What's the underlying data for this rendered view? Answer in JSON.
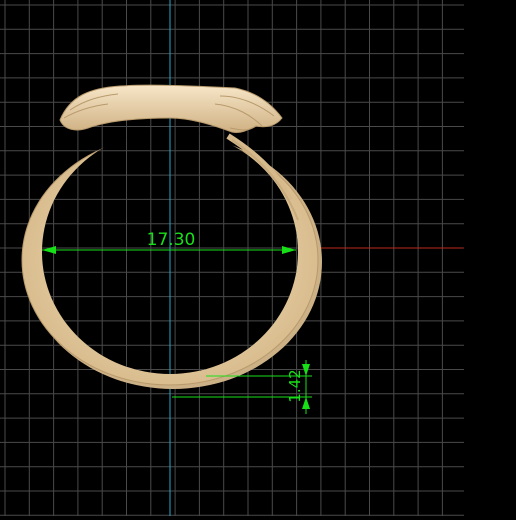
{
  "viewport": {
    "background": "#000000",
    "grid_color": "#4a4a4a",
    "axis_x_color": "#c0271b",
    "axis_y_color": "#27a9c9",
    "dimension_color": "#18e018",
    "ring_color": "#ecd3a8"
  },
  "dimensions": {
    "inner_diameter": "17.30",
    "band_thickness": "1.42"
  }
}
